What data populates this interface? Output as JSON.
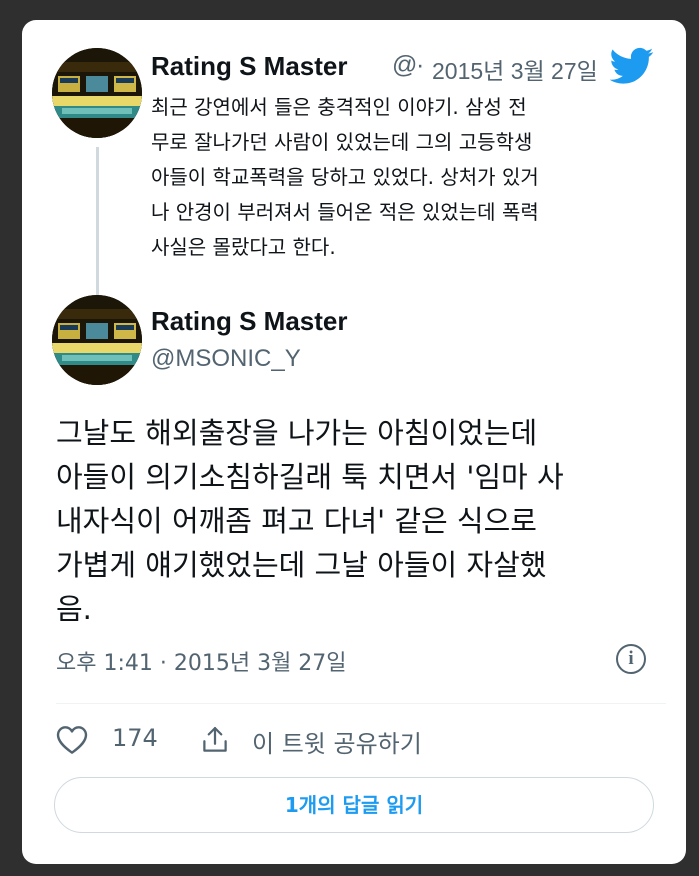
{
  "quoted_tweet": {
    "author_name": "Rating S Master",
    "handle_truncated": "@",
    "separator": "·",
    "date": "2015년 3월 27일",
    "text": "최근 강연에서 들은 충격적인 이야기. 삼성 전\n무로 잘나가던 사람이 있었는데 그의 고등학생\n아들이 학교폭력을 당하고 있었다. 상처가 있거\n나 안경이 부러져서 들어온 적은 있었는데 폭력\n사실은 몰랐다고 한다."
  },
  "main_tweet": {
    "author_name": "Rating S Master",
    "handle": "@MSONIC_Y",
    "text": "그날도 해외출장을 나가는 아침이었는데\n아들이 의기소침하길래 툭 치면서 '임마 사\n내자식이 어깨좀 펴고 다녀' 같은 식으로\n가볍게 얘기했었는데 그날 아들이 자살했\n음.",
    "timestamp": "오후 1:41 · 2015년 3월 27일",
    "info_glyph": "i"
  },
  "actions": {
    "like_count": "174",
    "share_label": "이 트윗 공유하기",
    "read_replies_label": "1개의 답글 읽기"
  },
  "colors": {
    "background": "#2f2f2f",
    "card": "#ffffff",
    "text_primary": "#0f1419",
    "text_secondary": "#536471",
    "accent": "#1d9bf0",
    "border": "#cfd9de"
  },
  "icons": {
    "twitter_logo": "twitter-bird-icon",
    "like": "heart-icon",
    "share": "share-icon",
    "info": "info-icon"
  }
}
